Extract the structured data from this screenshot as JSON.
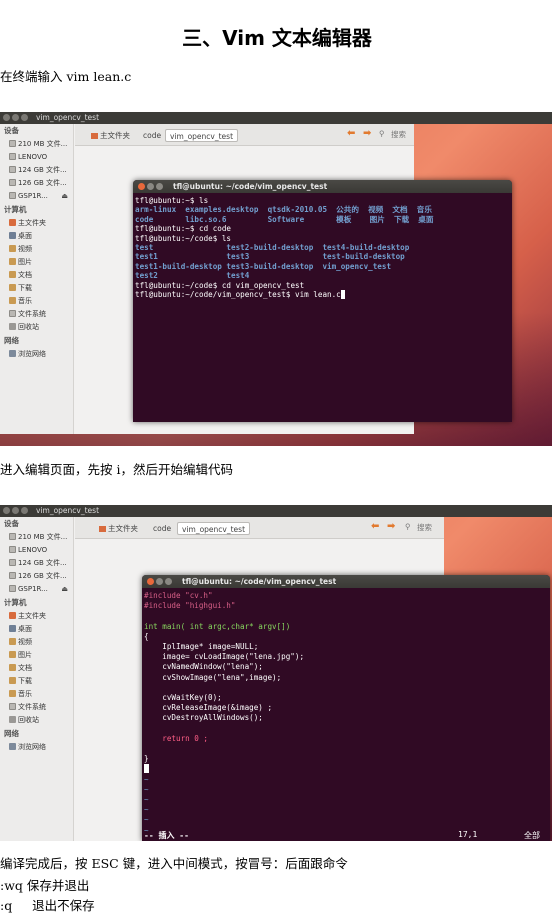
{
  "doc": {
    "title": "三、Vim 文本编辑器",
    "p1": "在终端输入 vim lean.c",
    "p2": "进入编辑页面，先按 i，然后开始编辑代码",
    "p3": "编译完成后，按 ESC 键，进入中间模式，按冒号：后面跟命令",
    "p4": ":wq  保存并退出",
    "p5": ":q     退出不保存"
  },
  "shot1": {
    "window_title": "vim_opencv_test",
    "sidebar": {
      "devices_header": "设备",
      "devices": [
        "210 MB 文件...",
        "LENOVO",
        "124 GB 文件...",
        "126 GB 文件...",
        "GSP1R..."
      ],
      "computer_header": "计算机",
      "computer": [
        "主文件夹",
        "桌面",
        "视频",
        "图片",
        "文档",
        "下载",
        "音乐",
        "文件系统",
        "回收站"
      ],
      "network_header": "网络",
      "network": [
        "浏览网络"
      ]
    },
    "toolbar": {
      "crumbs": [
        "主文件夹",
        "code",
        "vim_opencv_test"
      ],
      "search": "搜索"
    },
    "terminal_title": "tfl@ubuntu: ~/code/vim_opencv_test",
    "lines": [
      "tfl@ubuntu:~$ ls",
      "arm-linux  examples.desktop  qtsdk-2010.05  公共的  视频  文档  音乐",
      "code       libc.so.6         Software       模板    图片  下载  桌面",
      "tfl@ubuntu:~$ cd code",
      "tfl@ubuntu:~/code$ ls",
      "test                test2-build-desktop  test4-build-desktop",
      "test1               test3                test-build-desktop",
      "test1-build-desktop test3-build-desktop  vim_opencv_test",
      "test2               test4",
      "tfl@ubuntu:~/code$ cd vim_opencv_test",
      "tfl@ubuntu:~/code/vim_opencv_test$ vim lean.c"
    ]
  },
  "shot2": {
    "window_title": "vim_opencv_test",
    "terminal_title": "tfl@ubuntu: ~/code/vim_opencv_test",
    "code": [
      "#include \"cv.h\"",
      "#include \"highgui.h\"",
      "",
      "int main( int argc,char* argv[])",
      "{",
      "    IplImage* image=NULL;",
      "    image= cvLoadImage(\"lena.jpg\");",
      "    cvNamedWindow(\"lena\");",
      "    cvShowImage(\"lena\",image);",
      "",
      "    cvWaitKey(0);",
      "    cvReleaseImage(&image) ;",
      "    cvDestroyAllWindows();",
      "",
      "    return 0 ;",
      "",
      "}"
    ],
    "status_mode": "-- 插入 --",
    "status_pos": "17,1",
    "status_scroll": "全部"
  }
}
